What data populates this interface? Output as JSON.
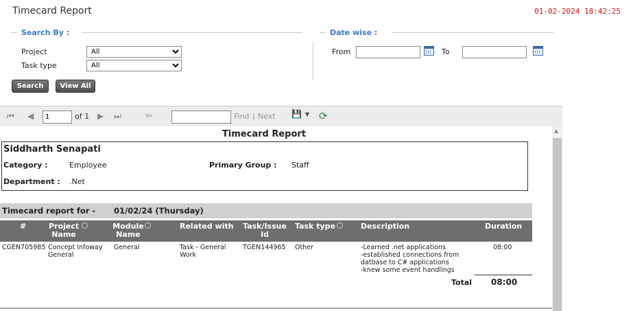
{
  "header": {
    "title": "Timecard Report",
    "timestamp": "01-02-2024 18:42:25"
  },
  "search": {
    "section_label": "Search By :",
    "project_label": "Project",
    "project_value": "All",
    "task_type_label": "Task type",
    "task_type_value": "All",
    "search_button": "Search",
    "view_all_button": "View All"
  },
  "datewise": {
    "section_label": "Date wise :",
    "from_label": "From",
    "to_label": "To",
    "from_value": "",
    "to_value": ""
  },
  "toolbar": {
    "page_value": "1",
    "of_label": "of 1",
    "find_value": "",
    "find_label": "Find",
    "sep": "|",
    "next_label": "Next"
  },
  "report": {
    "title": "Timecard Report",
    "employee_name": "Siddharth Senapati",
    "category_label": "Category :",
    "category_value": "Employee",
    "primary_group_label": "Primary Group :",
    "primary_group_value": "Staff",
    "department_label": "Department :",
    "department_value": ".Net",
    "report_for_label": "Timecard report for -",
    "report_for_date": "01/02/24 (Thursday)",
    "columns": {
      "num": "#",
      "project_a": "Project",
      "project_b": "Name",
      "module_a": "Module",
      "module_b": "Name",
      "related": "Related with",
      "task_a": "Task/Issue",
      "task_b": "Id",
      "task_type": "Task type",
      "description": "Description",
      "duration": "Duration"
    },
    "row": {
      "num": "CGEN705985",
      "project_a": "Concept Infoway",
      "project_b": "General",
      "module": "General",
      "related_a": "Task - General",
      "related_b": "Work",
      "task_id": "TGEN144965",
      "task_type": "Other",
      "desc_1": "-Learned .net applications",
      "desc_2": "-established connections from",
      "desc_3": "datbase to C# applications",
      "desc_4": "-knew some event handlings",
      "duration": "08:00"
    },
    "total_label": "Total",
    "total_value": "08:00"
  },
  "colors": {
    "accent": "#3a7bd5",
    "timestamp": "#d0121b",
    "header_bg": "#6e6e6e",
    "bar_bg": "#d0d0d0"
  }
}
